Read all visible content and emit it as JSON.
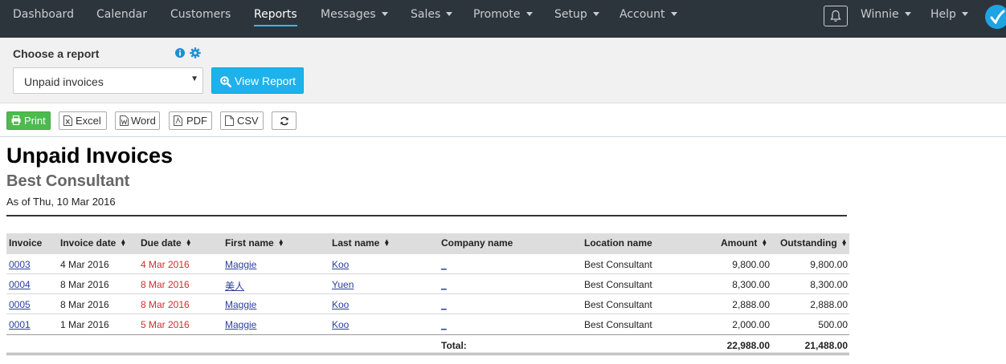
{
  "nav": {
    "items": [
      {
        "label": "Dashboard"
      },
      {
        "label": "Calendar"
      },
      {
        "label": "Customers"
      },
      {
        "label": "Reports"
      },
      {
        "label": "Messages"
      },
      {
        "label": "Sales"
      },
      {
        "label": "Promote"
      },
      {
        "label": "Setup"
      },
      {
        "label": "Account"
      }
    ],
    "active": "Reports",
    "user": "Winnie",
    "help": "Help"
  },
  "chooser": {
    "label": "Choose a report",
    "selected": "Unpaid invoices",
    "view_button": "View Report"
  },
  "toolbar": {
    "print": "Print",
    "excel": "Excel",
    "word": "Word",
    "pdf": "PDF",
    "csv": "CSV"
  },
  "report": {
    "title": "Unpaid Invoices",
    "subtitle": "Best Consultant",
    "as_of": "As of Thu, 10 Mar 2016"
  },
  "table": {
    "columns": [
      "Invoice",
      "Invoice date",
      "Due date",
      "First name",
      "Last name",
      "Company name",
      "Location name",
      "Amount",
      "Outstanding"
    ],
    "rows": [
      {
        "invoice": "0003",
        "invoice_date": "4 Mar 2016",
        "due_date": "4 Mar 2016",
        "first_name": "Maggie",
        "last_name": "Koo",
        "company": "_",
        "location": "Best Consultant",
        "amount": "9,800.00",
        "outstanding": "9,800.00"
      },
      {
        "invoice": "0004",
        "invoice_date": "8 Mar 2016",
        "due_date": "8 Mar 2016",
        "first_name": "美人",
        "last_name": "Yuen",
        "company": "_",
        "location": "Best Consultant",
        "amount": "8,300.00",
        "outstanding": "8,300.00"
      },
      {
        "invoice": "0005",
        "invoice_date": "8 Mar 2016",
        "due_date": "8 Mar 2016",
        "first_name": "Maggie",
        "last_name": "Koo",
        "company": "_",
        "location": "Best Consultant",
        "amount": "2,888.00",
        "outstanding": "2,888.00"
      },
      {
        "invoice": "0001",
        "invoice_date": "1 Mar 2016",
        "due_date": "5 Mar 2016",
        "first_name": "Maggie",
        "last_name": "Koo",
        "company": "_",
        "location": "Best Consultant",
        "amount": "2,000.00",
        "outstanding": "500.00"
      }
    ],
    "total_label": "Total:",
    "total_amount": "22,988.00",
    "total_outstanding": "21,488.00"
  },
  "colors": {
    "nav_bg": "#2d353c",
    "accent": "#1eb2ea",
    "print_green": "#4cbb4e",
    "overdue_red": "#d12e2e",
    "link_blue": "#2b3f9c"
  }
}
